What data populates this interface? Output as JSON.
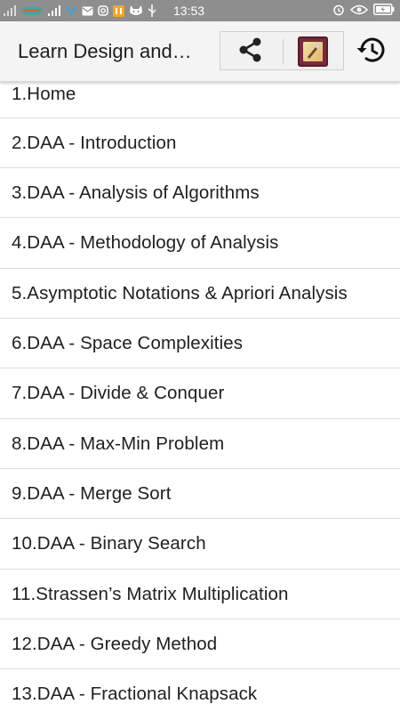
{
  "status_bar": {
    "time": "13:53",
    "left_icons": [
      "signal-icon",
      "carrier-icon",
      "signal-icon",
      "twitter-icon",
      "mail-icon",
      "instagram-icon",
      "app-icon",
      "cat-icon",
      "usb-icon"
    ],
    "right_icons": [
      "alarm-icon",
      "eye-icon",
      "battery-icon"
    ]
  },
  "app_bar": {
    "title": "Learn Design and…",
    "icons": [
      "share-icon",
      "book-icon",
      "history-icon"
    ]
  },
  "list": {
    "items": [
      {
        "label": "1.Home"
      },
      {
        "label": "2.DAA - Introduction"
      },
      {
        "label": "3.DAA - Analysis of Algorithms"
      },
      {
        "label": "4.DAA - Methodology of Analysis"
      },
      {
        "label": "5.Asymptotic Notations & Apriori Analysis"
      },
      {
        "label": "6.DAA - Space Complexities"
      },
      {
        "label": "7.DAA - Divide & Conquer"
      },
      {
        "label": "8.DAA - Max-Min Problem"
      },
      {
        "label": "9.DAA - Merge Sort"
      },
      {
        "label": "10.DAA - Binary Search"
      },
      {
        "label": "11.Strassen’s Matrix Multiplication"
      },
      {
        "label": "12.DAA - Greedy Method"
      },
      {
        "label": "13.DAA - Fractional Knapsack"
      }
    ]
  },
  "colors": {
    "status_bar": "#8e8e8e",
    "app_bar": "#f4f4f4",
    "text": "#202020",
    "divider": "#dcdcdc"
  }
}
